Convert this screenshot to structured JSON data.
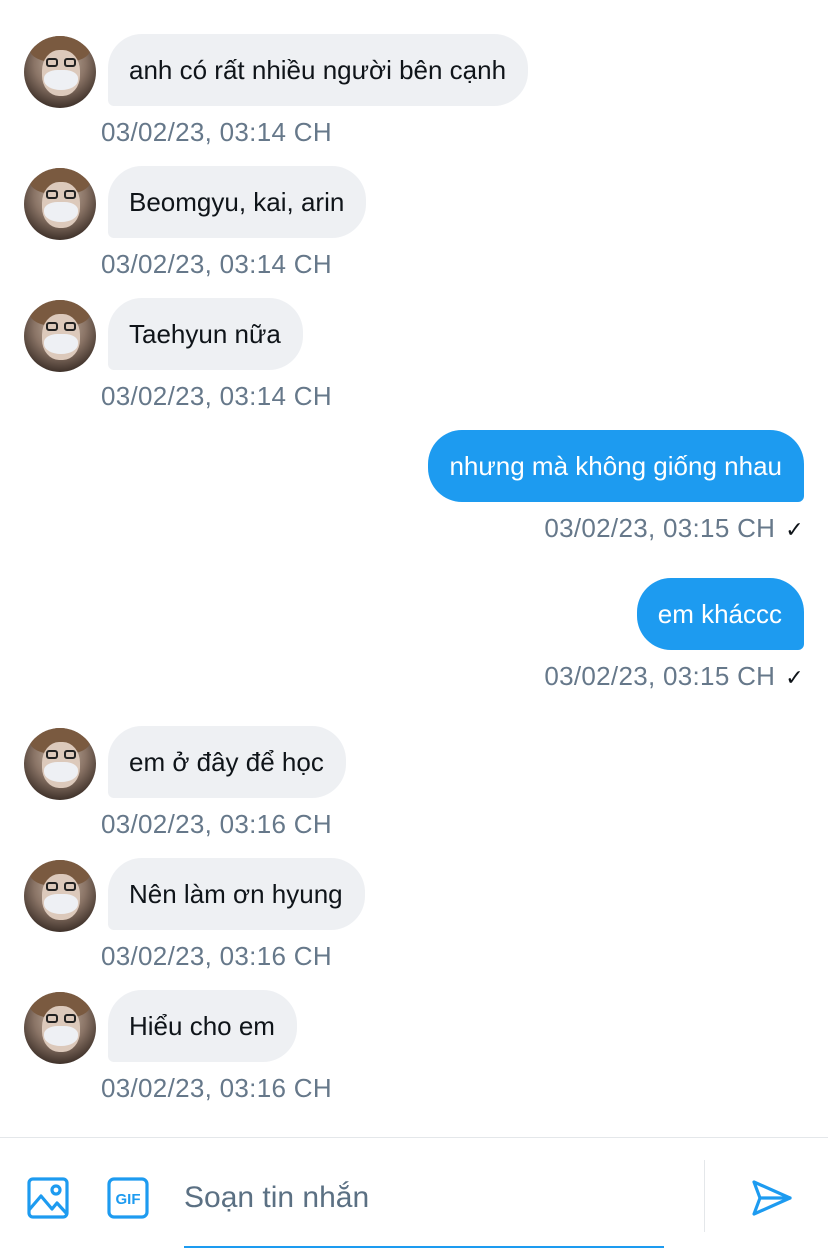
{
  "messages": [
    {
      "direction": "in",
      "text": "anh có rất nhiều người bên cạnh",
      "time": "03/02/23, 03:14 CH"
    },
    {
      "direction": "in",
      "text": "Beomgyu, kai, arin",
      "time": "03/02/23, 03:14 CH"
    },
    {
      "direction": "in",
      "text": "Taehyun nữa",
      "time": "03/02/23, 03:14 CH"
    },
    {
      "direction": "out",
      "text": "nhưng mà không giống nhau",
      "time": "03/02/23, 03:15 CH",
      "status": "✓"
    },
    {
      "direction": "out",
      "text": "em kháccc",
      "time": "03/02/23, 03:15 CH",
      "status": "✓"
    },
    {
      "direction": "in",
      "text": "em ở đây để học",
      "time": "03/02/23, 03:16 CH"
    },
    {
      "direction": "in",
      "text": "Nên làm ơn hyung",
      "time": "03/02/23, 03:16 CH"
    },
    {
      "direction": "in",
      "text": "Hiểu cho em",
      "time": "03/02/23, 03:16 CH"
    }
  ],
  "composer": {
    "placeholder": "Soạn tin nhắn",
    "gif_label": "GIF",
    "image_icon": "image-icon",
    "gif_icon": "gif-icon",
    "send_icon": "send-icon"
  },
  "colors": {
    "accent": "#1d9bf0",
    "incoming_bubble": "#eef0f3",
    "timestamp": "#66788a"
  }
}
